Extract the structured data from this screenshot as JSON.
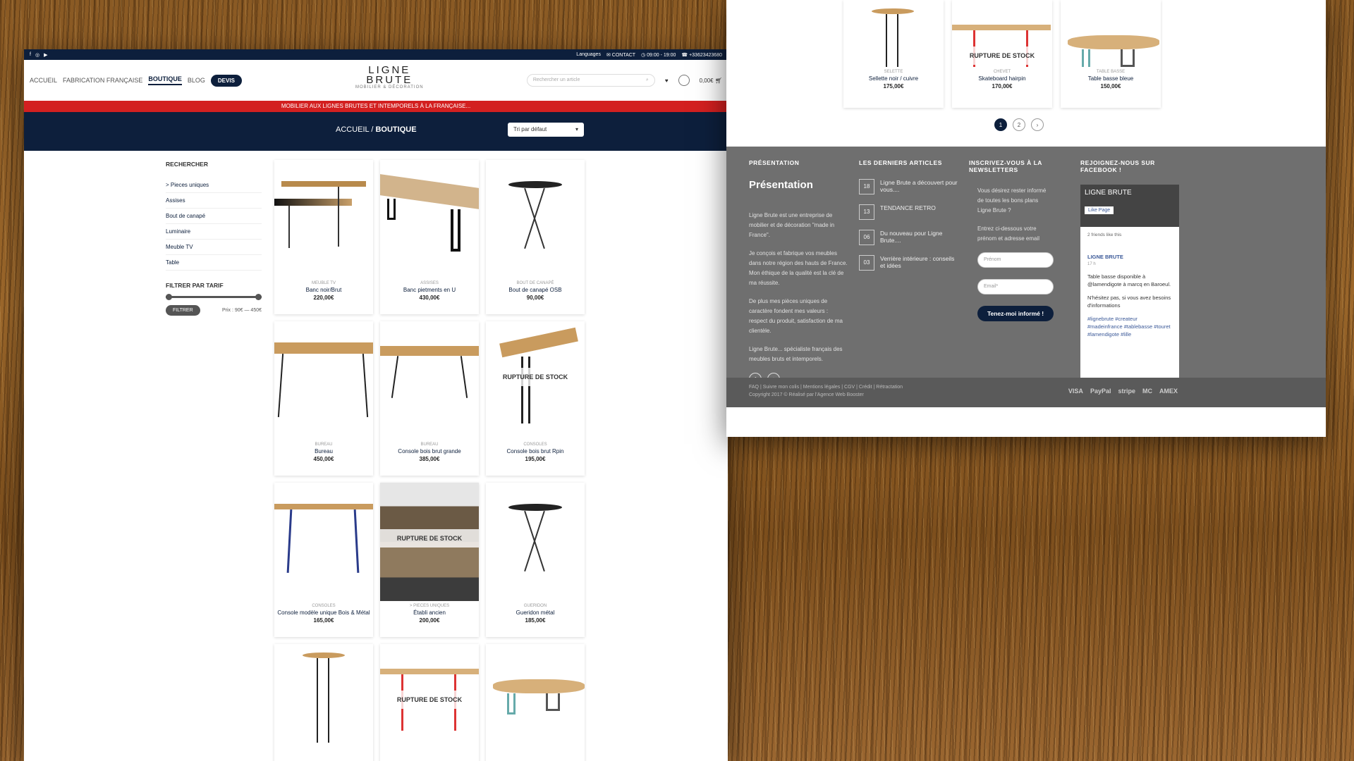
{
  "topbar": {
    "languages": "Languages",
    "contact": "CONTACT",
    "hours": "09:00 - 19:00",
    "phone": "+33623423680"
  },
  "nav": {
    "items": [
      "ACCUEIL",
      "FABRICATION FRANÇAISE",
      "BOUTIQUE",
      "BLOG"
    ],
    "devis": "DEVIS"
  },
  "logo": {
    "line1": "LIGNE",
    "line2": "BRUTE",
    "tagline": "MOBILIER & DÉCORATION"
  },
  "header": {
    "search_placeholder": "Rechercher un article",
    "cart": "0,00€"
  },
  "promo": "MOBILIER AUX LIGNES BRUTES ET INTEMPORELS À LA FRANÇAISE...",
  "breadcrumb": {
    "home": "ACCUEIL",
    "sep": "/",
    "current": "BOUTIQUE"
  },
  "sort": "Tri par défaut",
  "sidebar": {
    "title": "RECHERCHER",
    "items": [
      "> Pieces uniques",
      "Assises",
      "Bout de canapé",
      "Luminaire",
      "Meuble TV",
      "Table"
    ],
    "filter_title": "FILTRER PAR TARIF",
    "filter_btn": "FILTRER",
    "price_range": "Prix : 90€ — 450€"
  },
  "products": [
    {
      "cat": "MEUBLE TV",
      "name": "Banc noir/Brut",
      "price": "220,00€",
      "oos": ""
    },
    {
      "cat": "ASSISES",
      "name": "Banc pietments en U",
      "price": "430,00€",
      "oos": ""
    },
    {
      "cat": "BOUT DE CANAPÉ",
      "name": "Bout de canapé OSB",
      "price": "90,00€",
      "oos": ""
    },
    {
      "cat": "BUREAU",
      "name": "Bureau",
      "price": "450,00€",
      "oos": ""
    },
    {
      "cat": "BUREAU",
      "name": "Console bois brut grande",
      "price": "385,00€",
      "oos": ""
    },
    {
      "cat": "CONSOLES",
      "name": "Console bois brut Rpin",
      "price": "195,00€",
      "oos": "RUPTURE DE STOCK"
    },
    {
      "cat": "CONSOLES",
      "name": "Console modèle unique Bois & Métal",
      "price": "165,00€",
      "oos": ""
    },
    {
      "cat": "> PIECES UNIQUES",
      "name": "Établi ancien",
      "price": "200,00€",
      "oos": "RUPTURE DE STOCK"
    },
    {
      "cat": "GUERIDON",
      "name": "Gueridon métal",
      "price": "185,00€",
      "oos": ""
    },
    {
      "cat": "",
      "name": "",
      "price": "",
      "oos": ""
    },
    {
      "cat": "",
      "name": "",
      "price": "",
      "oos": "RUPTURE DE STOCK"
    },
    {
      "cat": "",
      "name": "",
      "price": "",
      "oos": ""
    }
  ],
  "right_products": [
    {
      "cat": "SELETTE",
      "name": "Sellette noir / cuivre",
      "price": "175,00€",
      "oos": ""
    },
    {
      "cat": "CHEVET",
      "name": "Skateboard hairpin",
      "price": "170,00€",
      "oos": "RUPTURE DE STOCK"
    },
    {
      "cat": "TABLE BASSE",
      "name": "Table basse bleue",
      "price": "150,00€",
      "oos": ""
    }
  ],
  "pagination": [
    "1",
    "2",
    "›"
  ],
  "footer": {
    "presentation": {
      "heading": "PRÉSENTATION",
      "title": "Présentation",
      "p1": "Ligne Brute est une entreprise de mobilier et de décoration \"made in France\".",
      "p2": "Je conçois et fabrique vos meubles dans notre région des hauts de France. Mon éthique de la qualité est la clé de ma réussite.",
      "p3": "De plus mes pièces uniques de caractère fondent mes valeurs : respect du produit, satisfaction de ma clientèle.",
      "p4": "Ligne Brute... spécialiste français des meubles bruts et intemporels."
    },
    "articles": {
      "heading": "LES DERNIERS ARTICLES",
      "items": [
        {
          "day": "18",
          "title": "Ligne Brute a découvert pour vous...."
        },
        {
          "day": "13",
          "title": "TENDANCE RETRO"
        },
        {
          "day": "06",
          "title": "Du nouveau pour Ligne Brute...."
        },
        {
          "day": "03",
          "title": "Verrière intérieure : conseils et idées"
        }
      ]
    },
    "newsletter": {
      "heading": "INSCRIVEZ-VOUS À LA NEWSLETTERS",
      "p1": "Vous désirez rester informé de toutes les bons plans Ligne Brute ?",
      "p2": "Entrez ci-dessous votre prénom et adresse email",
      "first": "Prénom",
      "email": "Email*",
      "btn": "Tenez-moi informé !"
    },
    "facebook": {
      "heading": "REJOIGNEZ-NOUS SUR FACEBOOK !",
      "page": "LIGNE BRUTE",
      "like": "Like Page",
      "friends": "2 friends like this",
      "author": "LIGNE BRUTE",
      "time": "17 h",
      "post": "Table basse disponible à @lamendigote à marcq en Baroeul.",
      "post2": "N'hésitez pas, si vous avez besoins d'informations",
      "tags": "#lignebrute #createur #madeinfrance #tablebasse #touret #lamendigote #lille"
    },
    "links": "FAQ | Suivre mon colis | Mentions légales | CGV | Crédit | Rétractation",
    "copyright": "Copyright 2017 © Réalisé par l'Agence Web Booster",
    "payments": [
      "VISA",
      "PayPal",
      "stripe",
      "MC",
      "AMEX"
    ]
  }
}
